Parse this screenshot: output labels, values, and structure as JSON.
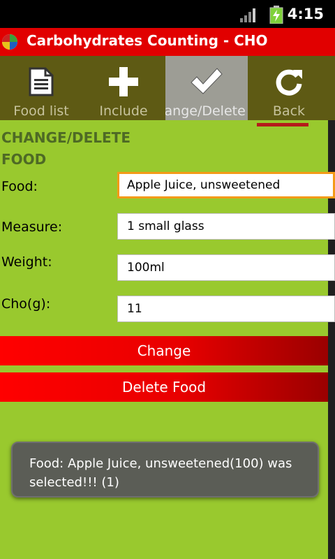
{
  "status_bar": {
    "time": "4:15"
  },
  "app": {
    "title": "Carbohydrates Counting - CHO"
  },
  "toolbar": {
    "items": [
      {
        "label": "Food list",
        "icon": "document-icon"
      },
      {
        "label": "Include",
        "icon": "plus-icon"
      },
      {
        "label": "Change/Delete",
        "icon": "checkmark-icon",
        "active": true
      },
      {
        "label": "Back",
        "icon": "refresh-arrow-icon"
      }
    ]
  },
  "form": {
    "heading_line1": "CHANGE/DELETE",
    "heading_line2": "FOOD",
    "food_label": "Food:",
    "food_value": "Apple Juice, unsweetened",
    "measure_label": "Measure:",
    "measure_value": "1 small glass",
    "weight_label": "Weight:",
    "weight_value": "100ml",
    "cho_label": "Cho(g):",
    "cho_value": "11"
  },
  "buttons": {
    "change": "Change",
    "delete": "Delete Food"
  },
  "toast": {
    "message": "Food: Apple Juice, unsweetened(100) was selected!!! (1)"
  },
  "colors": {
    "title_red": "#e10000",
    "toolbar_olive": "#5e5a14",
    "content_green": "#99c92e",
    "focus_orange": "#f39a18"
  }
}
